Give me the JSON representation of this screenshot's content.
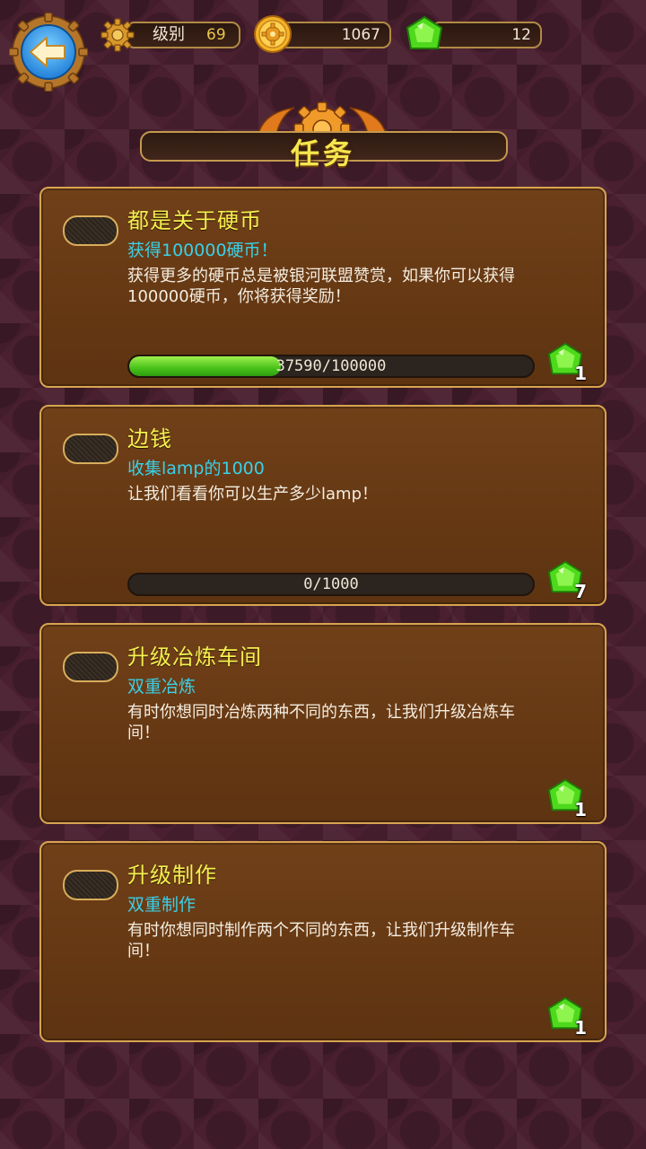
{
  "hud": {
    "level_label": "级别",
    "level_value": "69",
    "coins": "1067",
    "gems": "12"
  },
  "title": "任务",
  "colors": {
    "accent_yellow": "#f3ef4f",
    "subtitle_cyan": "#3ad0e8",
    "card_border": "#d7a450",
    "progress_green": "#47c21a",
    "back_button_blue": "#3b9be8"
  },
  "icons": {
    "back": "back-arrow-icon",
    "level": "gear-icon",
    "coin": "coin-icon",
    "gem": "green-gem-icon"
  },
  "quests": [
    {
      "title": "都是关于硬币",
      "subtitle": "获得100000硬币！",
      "description": "获得更多的硬币总是被银河联盟赞赏，如果你可以获得100000硬币，你将获得奖励！",
      "progress_text": "37590/100000",
      "progress_fraction": 0.3759,
      "reward": "1"
    },
    {
      "title": "边钱",
      "subtitle": "收集lamp的1000",
      "description": "让我们看看你可以生产多少lamp！",
      "progress_text": "0/1000",
      "progress_fraction": 0,
      "reward": "7"
    },
    {
      "title": "升级冶炼车间",
      "subtitle": "双重冶炼",
      "description": "有时你想同时冶炼两种不同的东西，让我们升级冶炼车间！",
      "reward": "1"
    },
    {
      "title": "升级制作",
      "subtitle": "双重制作",
      "description": "有时你想同时制作两个不同的东西，让我们升级制作车间！",
      "reward": "1"
    }
  ]
}
